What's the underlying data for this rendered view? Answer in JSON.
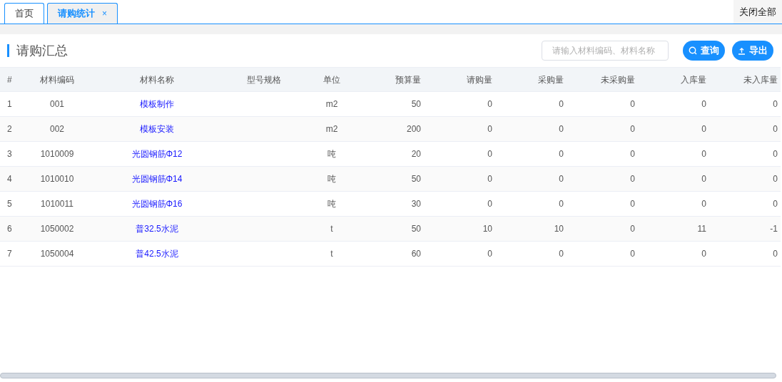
{
  "tabs": [
    {
      "label": "首页",
      "selected": false,
      "closable": false
    },
    {
      "label": "请购统计",
      "selected": true,
      "closable": true,
      "close_icon": "×"
    }
  ],
  "close_all": "关闭全部",
  "panel": {
    "title": "请购汇总",
    "search": {
      "placeholder": "请输入材料编码、材料名称"
    },
    "buttons": [
      {
        "kind": "search",
        "label": "查询"
      },
      {
        "kind": "export",
        "label": "导出"
      }
    ]
  },
  "table": {
    "columns": [
      "#",
      "材料编码",
      "材料名称",
      "型号规格",
      "单位",
      "预算量",
      "请购量",
      "采购量",
      "未采购量",
      "入库量",
      "未入库量"
    ],
    "rows": [
      {
        "cells": [
          "1",
          "001",
          "模板制作",
          "",
          "m2",
          "50",
          "0",
          "0",
          "0",
          "0",
          "0"
        ]
      },
      {
        "cells": [
          "2",
          "002",
          "模板安装",
          "",
          "m2",
          "200",
          "0",
          "0",
          "0",
          "0",
          "0"
        ]
      },
      {
        "cells": [
          "3",
          "1010009",
          "光圆钢筋Φ12",
          "",
          "吨",
          "20",
          "0",
          "0",
          "0",
          "0",
          "0"
        ]
      },
      {
        "cells": [
          "4",
          "1010010",
          "光圆钢筋Φ14",
          "",
          "吨",
          "50",
          "0",
          "0",
          "0",
          "0",
          "0"
        ]
      },
      {
        "cells": [
          "5",
          "1010011",
          "光圆钢筋Φ16",
          "",
          "吨",
          "30",
          "0",
          "0",
          "0",
          "0",
          "0"
        ]
      },
      {
        "cells": [
          "6",
          "1050002",
          "普32.5水泥",
          "",
          "t",
          "50",
          "10",
          "10",
          "0",
          "11",
          "-1"
        ]
      },
      {
        "cells": [
          "7",
          "1050004",
          "普42.5水泥",
          "",
          "t",
          "60",
          "0",
          "0",
          "0",
          "0",
          "0"
        ]
      }
    ]
  }
}
